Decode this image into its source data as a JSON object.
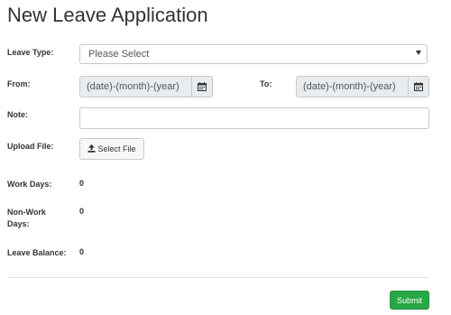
{
  "page": {
    "title": "New Leave Application"
  },
  "form": {
    "leave_type": {
      "label": "Leave Type:",
      "selected": "Please Select"
    },
    "from": {
      "label": "From:",
      "placeholder": "(date)-(month)-(year)"
    },
    "to": {
      "label": "To:",
      "placeholder": "(date)-(month)-(year)"
    },
    "note": {
      "label": "Note:",
      "value": ""
    },
    "upload": {
      "label": "Upload File:",
      "button_label": "Select File"
    },
    "work_days": {
      "label": "Work Days:",
      "value": "0"
    },
    "non_work_days": {
      "label_line1": "Non-Work",
      "label_line2": "Days:",
      "value": "0"
    },
    "leave_balance": {
      "label": "Leave Balance:",
      "value": "0"
    },
    "submit_label": "Submit"
  },
  "icons": {
    "calendar": "calendar-icon",
    "upload": "upload-icon",
    "dropdown": "chevron-down-icon"
  },
  "colors": {
    "submit": "#28a745",
    "input_disabled_bg": "#e9ecef"
  }
}
